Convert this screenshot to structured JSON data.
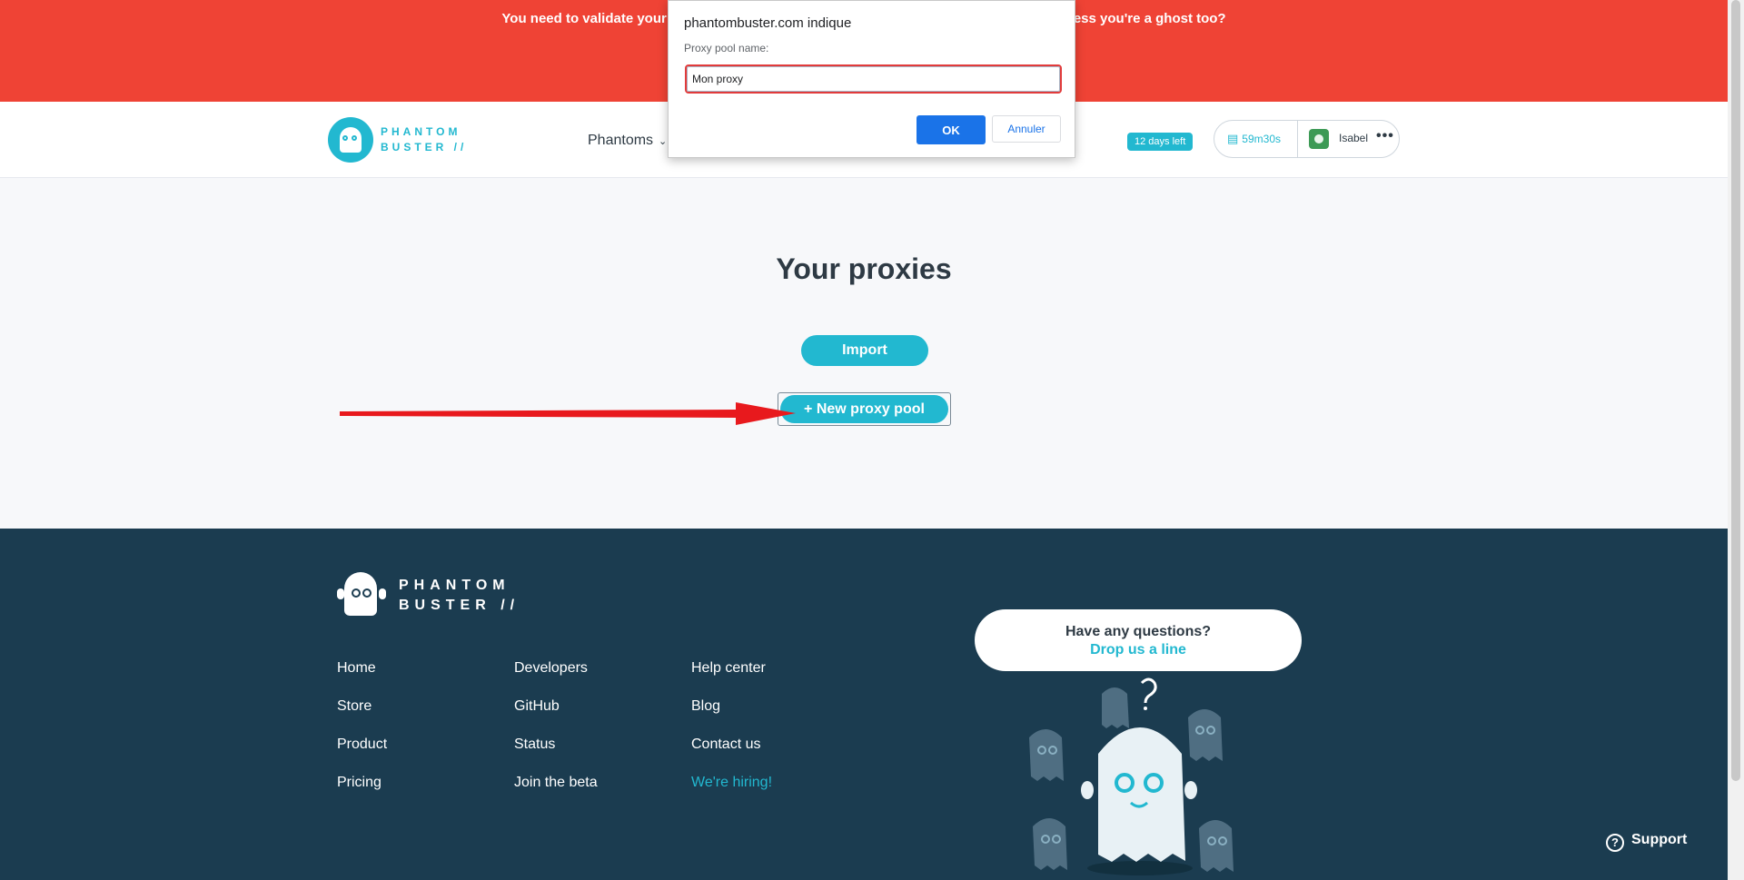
{
  "banner": {
    "text_left": "You need to validate your",
    "text_right": "ess you're a ghost too?"
  },
  "header": {
    "logo_line1": "PHANTOM",
    "logo_line2": "BUSTER //",
    "nav_phantoms": "Phantoms",
    "days_left": "12 days left",
    "time_remaining": "59m30s",
    "user_name": "Isabel",
    "more": "•••"
  },
  "main": {
    "title": "Your proxies",
    "import_label": "Import",
    "new_pool_label": "+ New proxy pool"
  },
  "dialog": {
    "origin": "phantombuster.com indique",
    "label": "Proxy pool name:",
    "input_value": "Mon proxy",
    "ok_label": "OK",
    "cancel_label": "Annuler"
  },
  "footer": {
    "logo_line1": "PHANTOM",
    "logo_line2": "BUSTER //",
    "col1": [
      "Home",
      "Store",
      "Product",
      "Pricing"
    ],
    "col2": [
      "Developers",
      "GitHub",
      "Status",
      "Join the beta"
    ],
    "col3": [
      "Help center",
      "Blog",
      "Contact us",
      "We're hiring!"
    ],
    "bubble_question": "Have any questions?",
    "bubble_link": "Drop us a line",
    "support_label": "Support"
  },
  "colors": {
    "banner": "#ef4335",
    "brand": "#22b8d0",
    "footer_bg": "#1b3c50",
    "dialog_ok": "#1a73e8",
    "arrow": "#e8191d"
  }
}
